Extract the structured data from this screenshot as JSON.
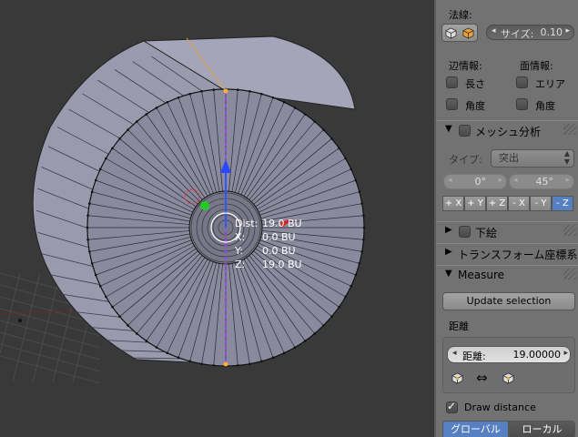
{
  "viewport": {
    "overlay": {
      "dist_label": "Dist:",
      "dist_value": "19.0 BU",
      "x_label": "X:",
      "x_value": "0.0 BU",
      "y_label": "Y:",
      "y_value": "0.0 BU",
      "z_label": "Z:",
      "z_value": "19.0 BU"
    }
  },
  "sidebar": {
    "normals": {
      "label": "法線:",
      "size_field": "サイズ:",
      "size_value": "0.10"
    },
    "edge_info": {
      "label": "辺情報:",
      "length": "長さ",
      "angle": "角度"
    },
    "face_info": {
      "label": "面情報:",
      "area": "エリア",
      "angle": "角度"
    },
    "mesh_analysis": {
      "title": "メッシュ分析",
      "type_label": "タイプ:",
      "type_value": "突出",
      "min_value": "0°",
      "max_value": "45°",
      "axes": [
        "+ X",
        "+ Y",
        "+ Z",
        "- X",
        "- Y",
        "- Z"
      ],
      "active_axis_index": 5
    },
    "background": {
      "title": "下絵"
    },
    "transform_orientation": {
      "title": "トランスフォーム座標系"
    },
    "measure": {
      "title": "Measure",
      "update_button": "Update selection",
      "distance_section": "距離",
      "distance_label": "距離:",
      "distance_value": "19.00000",
      "arrow_glyph": "⇔",
      "draw_distance": "Draw distance",
      "draw_distance_checked": true,
      "global_button": "グローバル",
      "local_button": "ローカル",
      "active_space": "グローバル"
    }
  }
}
